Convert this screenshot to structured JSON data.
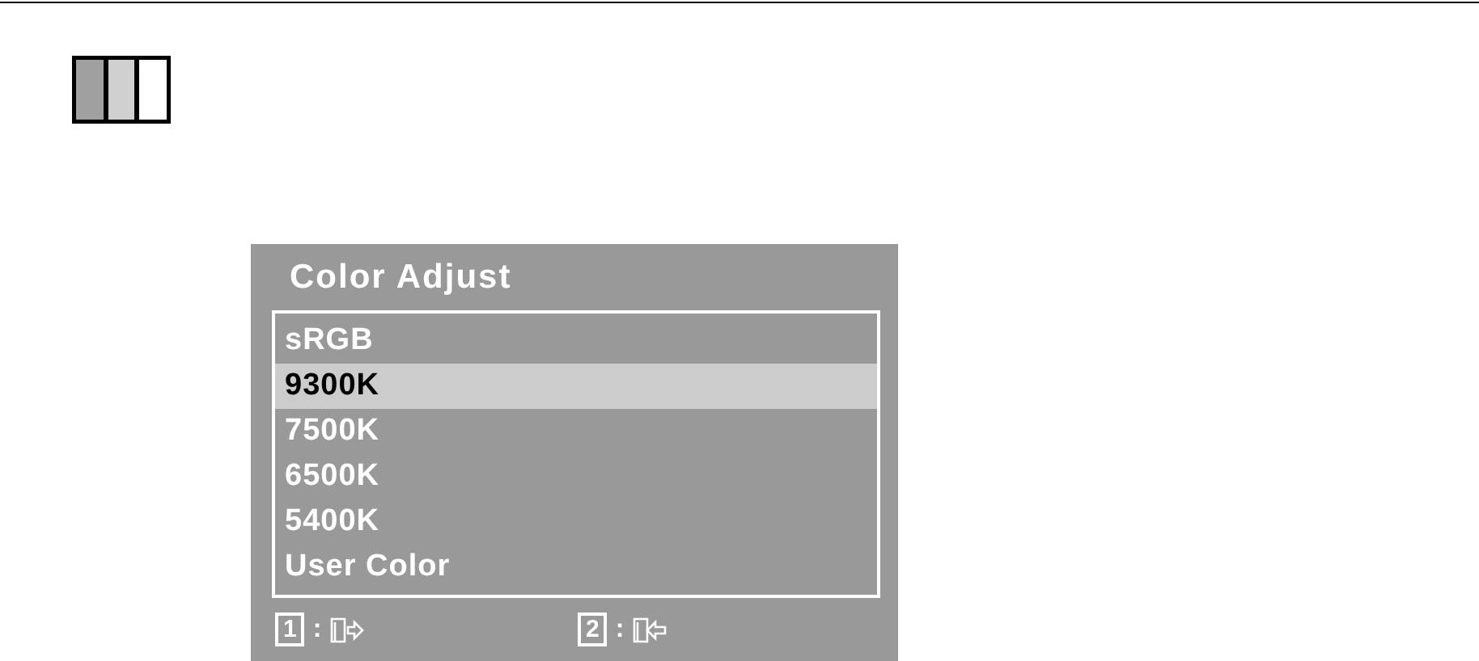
{
  "title": "Color Adjust",
  "options": [
    {
      "label": "sRGB",
      "selected": false
    },
    {
      "label": "9300K",
      "selected": true
    },
    {
      "label": "7500K",
      "selected": false
    },
    {
      "label": "6500K",
      "selected": false
    },
    {
      "label": "5400K",
      "selected": false
    },
    {
      "label": "User Color",
      "selected": false
    }
  ],
  "footer": [
    {
      "key": "1",
      "separator": ":",
      "kind": "exit"
    },
    {
      "key": "2",
      "separator": ":",
      "kind": "enter"
    }
  ]
}
